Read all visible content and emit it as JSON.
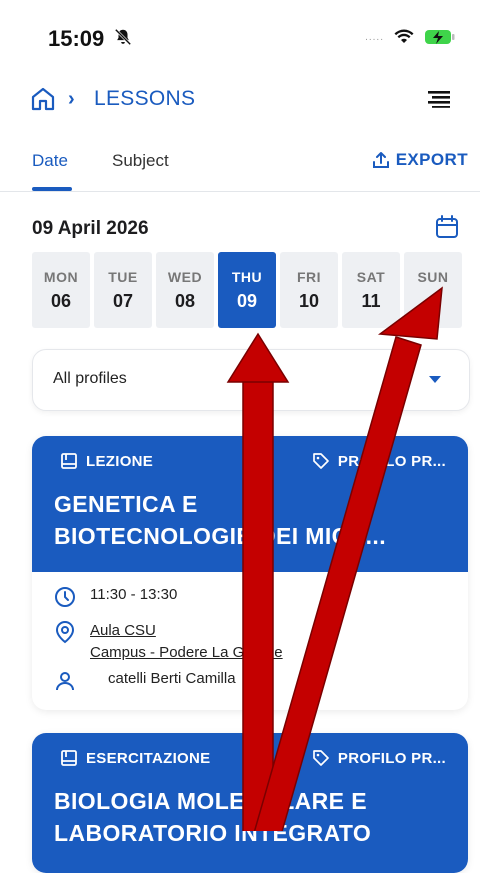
{
  "status": {
    "time": "15:09",
    "signal": "....."
  },
  "nav": {
    "breadcrumb": "LESSONS"
  },
  "tabs": {
    "date": "Date",
    "subject": "Subject",
    "export": "EXPORT"
  },
  "date_title": "09 April 2026",
  "week": [
    {
      "name": "MON",
      "num": "06"
    },
    {
      "name": "TUE",
      "num": "07"
    },
    {
      "name": "WED",
      "num": "08"
    },
    {
      "name": "THU",
      "num": "09",
      "selected": true
    },
    {
      "name": "FRI",
      "num": "10"
    },
    {
      "name": "SAT",
      "num": "11"
    },
    {
      "name": "SUN",
      "num": ""
    }
  ],
  "filter": {
    "label": "All profiles"
  },
  "lessons": [
    {
      "type": "LEZIONE",
      "profile": "PROFILO PR...",
      "title": "GENETICA E\nBIOTECNOLOGIE DEI MICR...",
      "time": "11:30 - 13:30",
      "location_line1": "Aula CSU",
      "location_line2": "Campus - Podere La Grande",
      "teacher": "catelli Berti Camilla"
    },
    {
      "type": "ESERCITAZIONE",
      "profile": "PROFILO PR...",
      "title": "BIOLOGIA MOLECOLARE E\nLABORATORIO INTEGRATO"
    }
  ],
  "colors": {
    "accent": "#1a5bbf",
    "annotation_arrow": "#c40000"
  }
}
